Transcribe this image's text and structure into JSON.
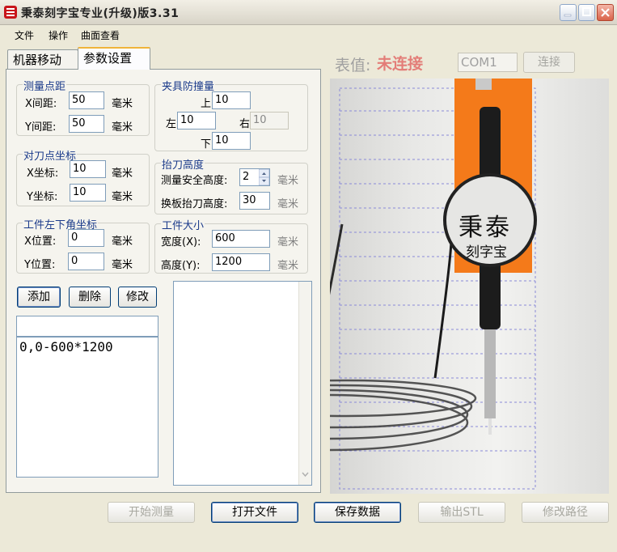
{
  "window": {
    "title": "秉泰刻字宝专业(升级)版3.31"
  },
  "menu": [
    "文件",
    "操作",
    "曲面查看"
  ],
  "tabs": [
    "机器移动",
    "参数设置"
  ],
  "measure_spacing": {
    "title": "测量点距",
    "x_label": "X间距:",
    "x_value": "50",
    "x_unit": "毫米",
    "y_label": "Y间距:",
    "y_value": "50",
    "y_unit": "毫米"
  },
  "tool_setting": {
    "title": "对刀点坐标",
    "x_label": "X坐标:",
    "x_value": "10",
    "x_unit": "毫米",
    "y_label": "Y坐标:",
    "y_value": "10",
    "y_unit": "毫米"
  },
  "workpiece_corner": {
    "title": "工件左下角坐标",
    "x_label": "X位置:",
    "x_value": "0",
    "x_unit": "毫米",
    "y_label": "Y位置:",
    "y_value": "0",
    "y_unit": "毫米"
  },
  "clamp_guard": {
    "title": "夹具防撞量",
    "top_label": "上",
    "top_value": "10",
    "left_label": "左",
    "left_value": "10",
    "right_label": "右",
    "right_value": "10",
    "bottom_label": "下",
    "bottom_value": "10"
  },
  "lift_height": {
    "title": "抬刀高度",
    "safe_label": "测量安全高度:",
    "safe_value": "2",
    "safe_unit": "毫米",
    "change_label": "换板抬刀高度:",
    "change_value": "30",
    "change_unit": "毫米"
  },
  "workpiece_size": {
    "title": "工件大小",
    "width_label": "宽度(X):",
    "width_value": "600",
    "width_unit": "毫米",
    "height_label": "高度(Y):",
    "height_value": "1200",
    "height_unit": "毫米"
  },
  "list_buttons": {
    "add": "添加",
    "delete": "删除",
    "modify": "修改"
  },
  "list": {
    "input_value": "",
    "items": [
      "0,0-600*1200"
    ]
  },
  "status": {
    "gauge_label": "表值:",
    "connection": "未连接",
    "port": "COM1",
    "connect_button": "连接"
  },
  "logo": {
    "line1": "秉泰",
    "line2": "刻字宝"
  },
  "bottom_buttons": {
    "start": "开始测量",
    "open": "打开文件",
    "save": "保存数据",
    "export": "输出STL",
    "path": "修改路径"
  },
  "colors": {
    "accent": "#F0B43A",
    "group_title": "#1A3A8A",
    "orange": "#F47A1A",
    "disconnected": "#E05050"
  }
}
